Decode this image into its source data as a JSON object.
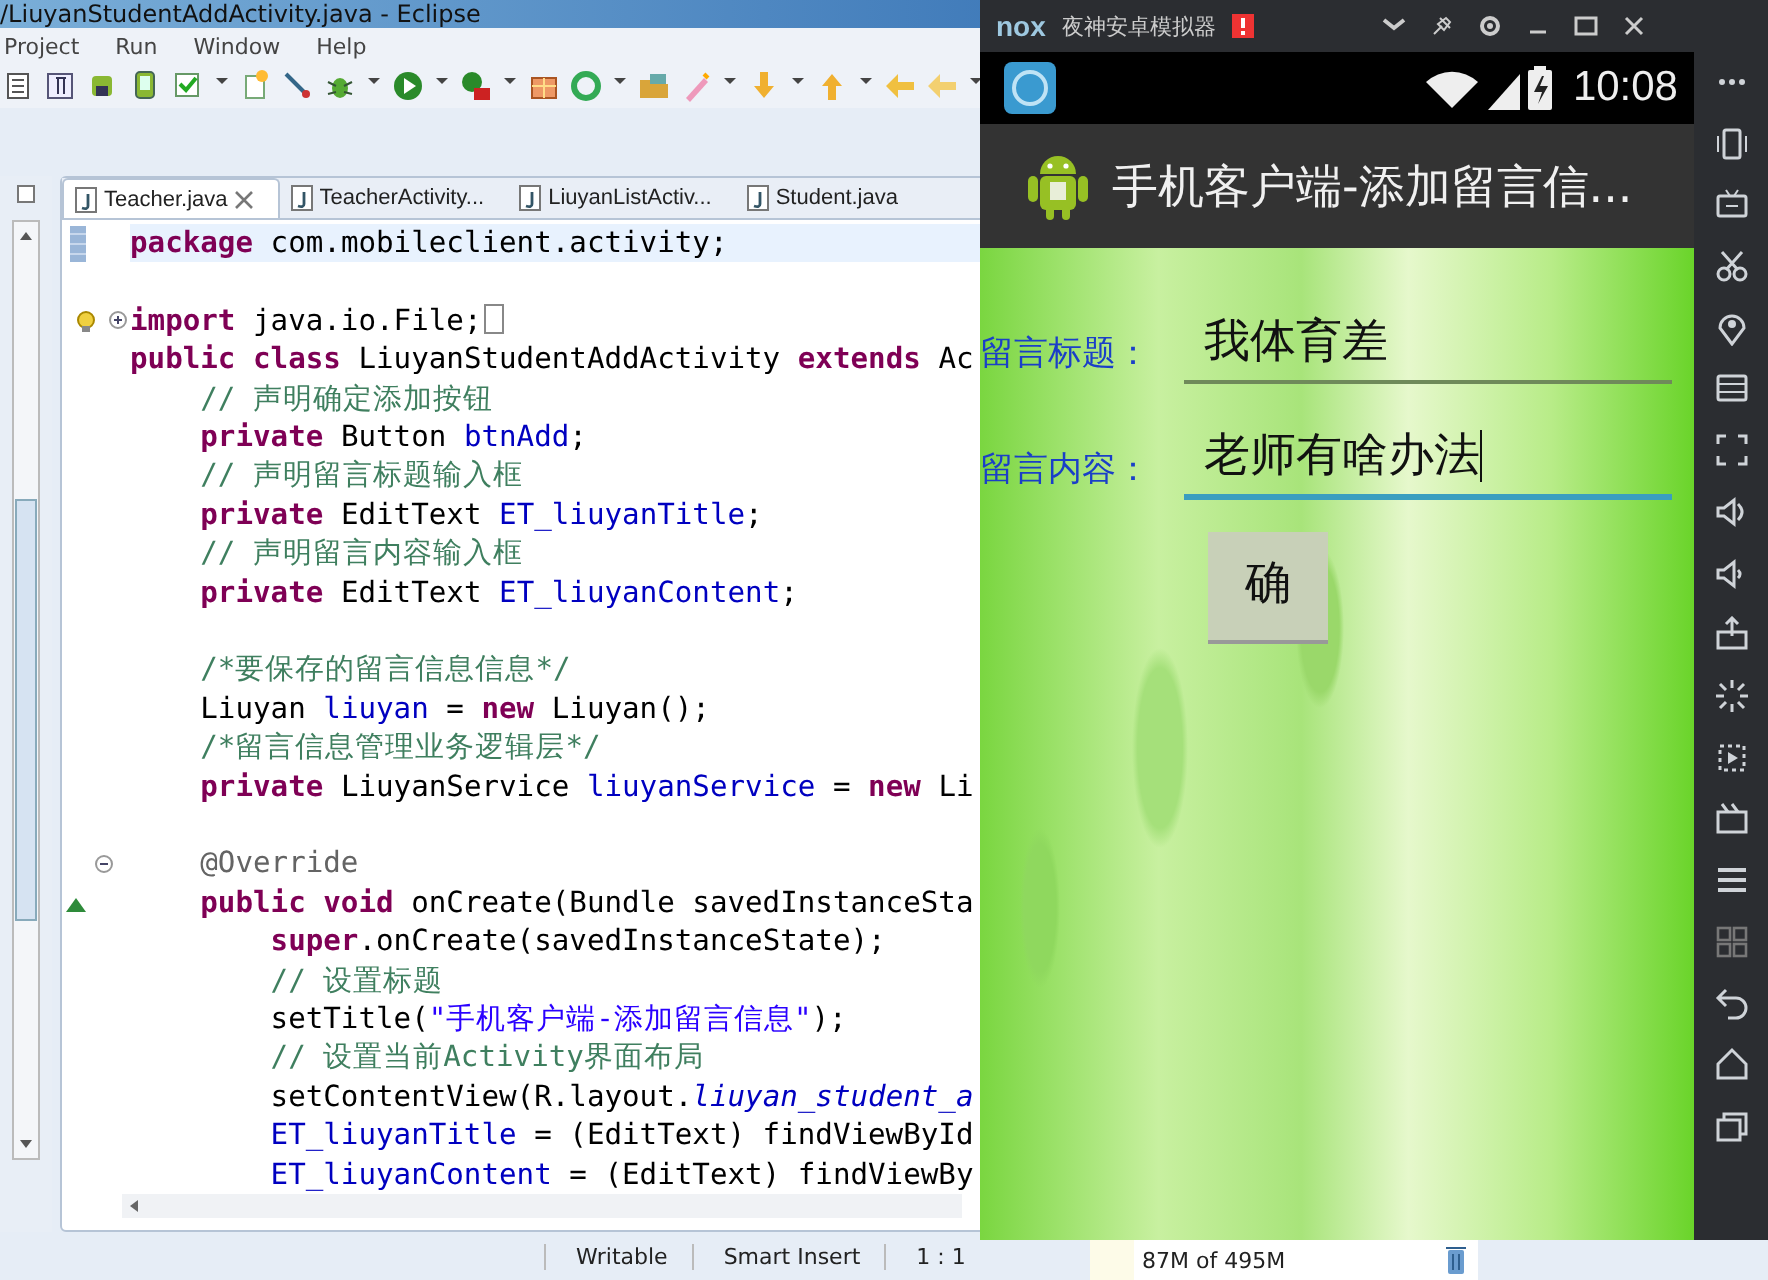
{
  "eclipse": {
    "title": "/LiuyanStudentAddActivity.java - Eclipse",
    "menu": [
      {
        "label": "Project"
      },
      {
        "label": "Run"
      },
      {
        "label": "Window"
      },
      {
        "label": "Help"
      }
    ],
    "tabs": [
      {
        "label": "Teacher.java",
        "selected": true,
        "closable": true
      },
      {
        "label": "TeacherActivity...",
        "selected": false,
        "closable": false
      },
      {
        "label": "LiuyanListActiv...",
        "selected": false,
        "closable": false
      },
      {
        "label": "Student.java",
        "selected": false,
        "closable": false
      }
    ],
    "code": [
      {
        "kind": "bookmark",
        "current": true,
        "blank_before": false,
        "folded": false,
        "segments": [
          {
            "kind": "kw",
            "text": "package"
          },
          {
            "kind": "plain",
            "text": " com.mobileclient.activity;"
          }
        ]
      },
      {
        "kind": "import",
        "current": false,
        "blank_before": true,
        "folded": true,
        "segments": [
          {
            "kind": "kw",
            "text": "import"
          },
          {
            "kind": "plain",
            "text": " java.io.File;"
          }
        ]
      },
      {
        "kind": "plain",
        "current": false,
        "blank_before": false,
        "folded": false,
        "segments": [
          {
            "kind": "kw",
            "text": "public class"
          },
          {
            "kind": "plain",
            "text": " LiuyanStudentAddActivity "
          },
          {
            "kind": "kw",
            "text": "extends"
          },
          {
            "kind": "plain",
            "text": " Ac"
          }
        ]
      },
      {
        "kind": "plain",
        "current": false,
        "blank_before": false,
        "folded": false,
        "segments": [
          {
            "kind": "comment",
            "text": "    // 声明确定添加按钮"
          }
        ]
      },
      {
        "kind": "plain",
        "current": false,
        "blank_before": false,
        "folded": false,
        "segments": [
          {
            "kind": "kw",
            "text": "    private"
          },
          {
            "kind": "plain",
            "text": " Button "
          },
          {
            "kind": "field",
            "text": "btnAdd"
          },
          {
            "kind": "plain",
            "text": ";"
          }
        ]
      },
      {
        "kind": "plain",
        "current": false,
        "blank_before": false,
        "folded": false,
        "segments": [
          {
            "kind": "comment",
            "text": "    // 声明留言标题输入框"
          }
        ]
      },
      {
        "kind": "plain",
        "current": false,
        "blank_before": false,
        "folded": false,
        "segments": [
          {
            "kind": "kw",
            "text": "    private"
          },
          {
            "kind": "plain",
            "text": " EditText "
          },
          {
            "kind": "field",
            "text": "ET_liuyanTitle"
          },
          {
            "kind": "plain",
            "text": ";"
          }
        ]
      },
      {
        "kind": "plain",
        "current": false,
        "blank_before": false,
        "folded": false,
        "segments": [
          {
            "kind": "comment",
            "text": "    // 声明留言内容输入框"
          }
        ]
      },
      {
        "kind": "plain",
        "current": false,
        "blank_before": false,
        "folded": false,
        "segments": [
          {
            "kind": "kw",
            "text": "    private"
          },
          {
            "kind": "plain",
            "text": " EditText "
          },
          {
            "kind": "field",
            "text": "ET_liuyanContent"
          },
          {
            "kind": "plain",
            "text": ";"
          }
        ]
      },
      {
        "kind": "plain",
        "current": false,
        "blank_before": true,
        "folded": false,
        "segments": [
          {
            "kind": "comment",
            "text": "    /*要保存的留言信息信息*/"
          }
        ]
      },
      {
        "kind": "plain",
        "current": false,
        "blank_before": false,
        "folded": false,
        "segments": [
          {
            "kind": "plain",
            "text": "    Liuyan "
          },
          {
            "kind": "field",
            "text": "liuyan"
          },
          {
            "kind": "plain",
            "text": " = "
          },
          {
            "kind": "kw",
            "text": "new"
          },
          {
            "kind": "plain",
            "text": " Liuyan();"
          }
        ]
      },
      {
        "kind": "plain",
        "current": false,
        "blank_before": false,
        "folded": false,
        "segments": [
          {
            "kind": "comment",
            "text": "    /*留言信息管理业务逻辑层*/"
          }
        ]
      },
      {
        "kind": "plain",
        "current": false,
        "blank_before": false,
        "folded": false,
        "segments": [
          {
            "kind": "kw",
            "text": "    private"
          },
          {
            "kind": "plain",
            "text": " LiuyanService "
          },
          {
            "kind": "field",
            "text": "liuyanService"
          },
          {
            "kind": "plain",
            "text": " = "
          },
          {
            "kind": "kw",
            "text": "new"
          },
          {
            "kind": "plain",
            "text": " Li"
          }
        ]
      },
      {
        "kind": "fold",
        "current": false,
        "blank_before": true,
        "folded": false,
        "segments": [
          {
            "kind": "annot",
            "text": "    @Override"
          }
        ]
      },
      {
        "kind": "override",
        "current": false,
        "blank_before": false,
        "folded": false,
        "segments": [
          {
            "kind": "kw",
            "text": "    public void"
          },
          {
            "kind": "plain",
            "text": " onCreate(Bundle savedInstanceSta"
          }
        ]
      },
      {
        "kind": "plain",
        "current": false,
        "blank_before": false,
        "folded": false,
        "segments": [
          {
            "kind": "kw",
            "text": "        super"
          },
          {
            "kind": "plain",
            "text": ".onCreate(savedInstanceState);"
          }
        ]
      },
      {
        "kind": "plain",
        "current": false,
        "blank_before": false,
        "folded": false,
        "segments": [
          {
            "kind": "comment",
            "text": "        // 设置标题"
          }
        ]
      },
      {
        "kind": "plain",
        "current": false,
        "blank_before": false,
        "folded": false,
        "segments": [
          {
            "kind": "plain",
            "text": "        setTitle("
          },
          {
            "kind": "string",
            "text": "\"手机客户端-添加留言信息\""
          },
          {
            "kind": "plain",
            "text": ");"
          }
        ]
      },
      {
        "kind": "plain",
        "current": false,
        "blank_before": false,
        "folded": false,
        "segments": [
          {
            "kind": "comment",
            "text": "        // 设置当前Activity界面布局"
          }
        ]
      },
      {
        "kind": "plain",
        "current": false,
        "blank_before": false,
        "folded": false,
        "segments": [
          {
            "kind": "plain",
            "text": "        setContentView(R.layout."
          },
          {
            "kind": "static",
            "text": "liuyan_student_a"
          }
        ]
      },
      {
        "kind": "plain",
        "current": false,
        "blank_before": false,
        "folded": false,
        "segments": [
          {
            "kind": "field",
            "text": "        ET_liuyanTitle"
          },
          {
            "kind": "plain",
            "text": " = (EditText) findViewById"
          }
        ]
      },
      {
        "kind": "plain",
        "current": false,
        "blank_before": false,
        "folded": false,
        "segments": [
          {
            "kind": "field",
            "text": "        ET_liuyanContent"
          },
          {
            "kind": "plain",
            "text": " = (EditText) findViewBy"
          }
        ]
      }
    ],
    "status_bar": [
      {
        "text": "Writable"
      },
      {
        "text": "Smart Insert"
      },
      {
        "text": "1 : 1"
      }
    ],
    "memory": "87M of 495M"
  },
  "emulator": {
    "title": "夜神安卓模拟器",
    "logo": "nox",
    "time": "10:08",
    "app_title": "手机客户端-添加留言信...",
    "form": [
      {
        "label": "留言标题：",
        "value": "我体育差",
        "focused": false
      },
      {
        "label": "留言内容：",
        "value": "老师有啥办法",
        "focused": true
      }
    ],
    "button": "确"
  }
}
